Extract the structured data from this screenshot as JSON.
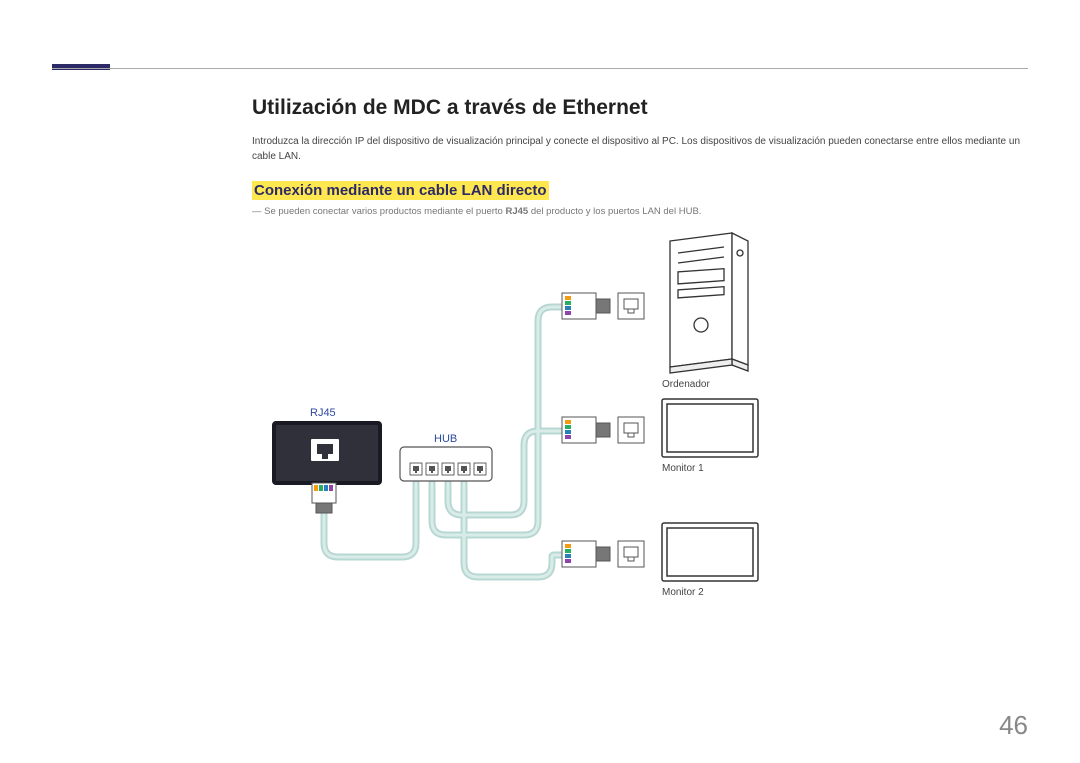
{
  "title": "Utilización de MDC a través de Ethernet",
  "intro": "Introduzca la dirección IP del dispositivo de visualización principal y conecte el dispositivo al PC. Los dispositivos de visualización pueden conectarse entre ellos mediante un cable LAN.",
  "subtitle": "Conexión mediante un cable LAN directo",
  "note_prefix": "― Se pueden conectar varios productos mediante el puerto ",
  "note_bold": "RJ45",
  "note_suffix": " del producto y los puertos LAN del HUB.",
  "labels": {
    "rj45": "RJ45",
    "hub": "HUB",
    "computer": "Ordenador",
    "monitor1": "Monitor 1",
    "monitor2": "Monitor 2"
  },
  "page_number": "46"
}
